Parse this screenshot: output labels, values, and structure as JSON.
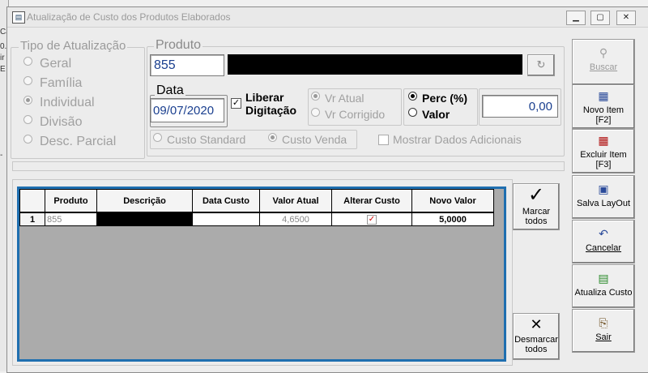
{
  "window": {
    "title": "Atualização de Custo dos Produtos Elaborados",
    "controls": [
      "minimize",
      "maximize",
      "close"
    ]
  },
  "background_fragments": [
    "Ca",
    "0.",
    "ir",
    "E",
    "-"
  ],
  "tipo_atualizacao": {
    "label": "Tipo de Atualização",
    "options": [
      "Geral",
      "Família",
      "Individual",
      "Divisão",
      "Desc. Parcial"
    ],
    "selected": "Individual"
  },
  "produto": {
    "label": "Produto",
    "code": "855",
    "refresh_icon": "refresh-icon"
  },
  "data": {
    "label": "Data",
    "value": "09/07/2020"
  },
  "liberar": {
    "label_line1": "Liberar",
    "label_line2": "Digitação",
    "checked": true
  },
  "vr_options": [
    "Vr Atual",
    "Vr Corrigido"
  ],
  "vr_selected": "Vr Atual",
  "perc_options": [
    "Perc (%)",
    "Valor"
  ],
  "perc_selected": "Perc (%)",
  "amount_value": "0,00",
  "custo_options": [
    "Custo Standard",
    "Custo Venda"
  ],
  "custo_selected": "Custo Venda",
  "mostrar_dados": "Mostrar Dados Adicionais",
  "grid": {
    "columns": [
      "Produto",
      "Descrição",
      "Data Custo",
      "Valor Atual",
      "Alterar Custo",
      "Novo Valor"
    ],
    "rows": [
      {
        "num": "1",
        "produto": "855",
        "descricao": "",
        "data_custo": "",
        "valor_atual": "4,6500",
        "alterar_custo": true,
        "novo_valor": "5,0000"
      }
    ]
  },
  "marcar_todos": {
    "line1": "Marcar",
    "line2": "todos"
  },
  "desmarcar_todos": {
    "line1": "Desmarcar",
    "line2": "todos"
  },
  "side_buttons": [
    {
      "name": "buscar",
      "label": "Buscar",
      "label2": "",
      "icon": "binoculars-icon",
      "disabled": true
    },
    {
      "name": "novo-item",
      "label": "Novo Item",
      "label2": "[F2]",
      "icon": "grid-icon",
      "disabled": false
    },
    {
      "name": "excluir-item",
      "label": "Excluir Item",
      "label2": "[F3]",
      "icon": "grid-delete-icon",
      "disabled": false
    },
    {
      "name": "salva-layout",
      "label": "Salva LayOut",
      "label2": "",
      "icon": "save-layout-icon",
      "disabled": false
    },
    {
      "name": "cancelar",
      "label": "Cancelar",
      "label2": "",
      "icon": "undo-icon",
      "disabled": false
    },
    {
      "name": "atualiza-custo",
      "label": "Atualiza Custo",
      "label2": "",
      "icon": "update-cost-icon",
      "disabled": false
    },
    {
      "name": "sair",
      "label": "Sair",
      "label2": "",
      "icon": "exit-door-icon",
      "disabled": false
    }
  ]
}
